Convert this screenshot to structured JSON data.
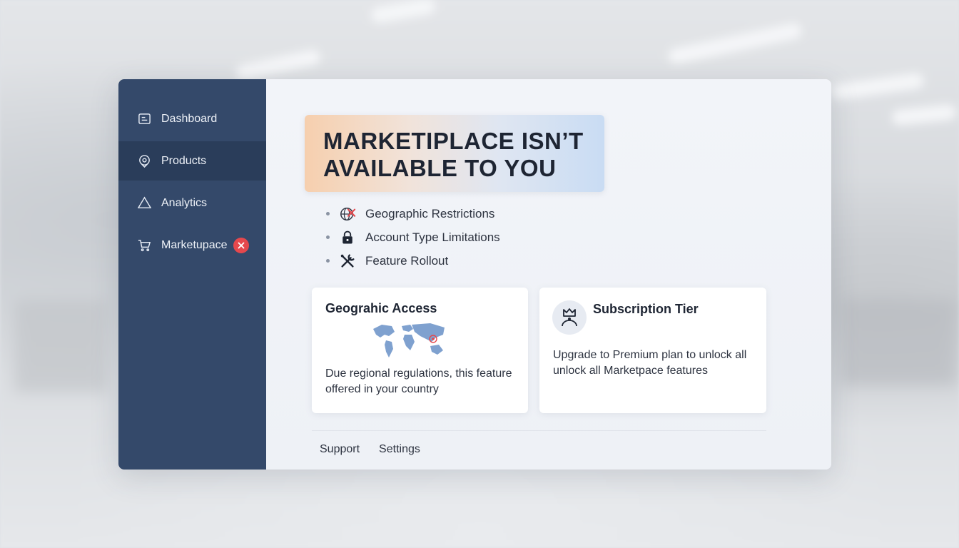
{
  "sidebar": {
    "items": [
      {
        "label": "Dashboard",
        "icon": "dashboard-icon"
      },
      {
        "label": "Products",
        "icon": "products-icon",
        "active": true
      },
      {
        "label": "Analytics",
        "icon": "analytics-icon"
      },
      {
        "label": "Marketupace",
        "icon": "cart-icon",
        "badge": "error-x-icon"
      }
    ]
  },
  "hero": {
    "title": "MARKETIPLACE ISN’T AVAILABLE TO YOU"
  },
  "reasons": [
    {
      "label": "Geographic Restrictions",
      "icon": "globe-blocked-icon"
    },
    {
      "label": "Account Type Limitations",
      "icon": "lock-icon"
    },
    {
      "label": "Feature Rollout",
      "icon": "tools-icon"
    }
  ],
  "cards": {
    "geo": {
      "title": "Geograhic Access",
      "body": "Due regional regulations, this feature offered in your country",
      "icon": "world-map-icon"
    },
    "subscription": {
      "title": "Subscription Tier",
      "body": "Upgrade to Premium plan to unlock all unlock all Marketpace features",
      "icon": "crown-user-icon"
    }
  },
  "footer": {
    "support": "Support",
    "settings": "Settings"
  },
  "colors": {
    "sidebar": "#34496a",
    "sidebar_active": "#2a3d5a",
    "error": "#e5484d",
    "text": "#1e2533"
  }
}
